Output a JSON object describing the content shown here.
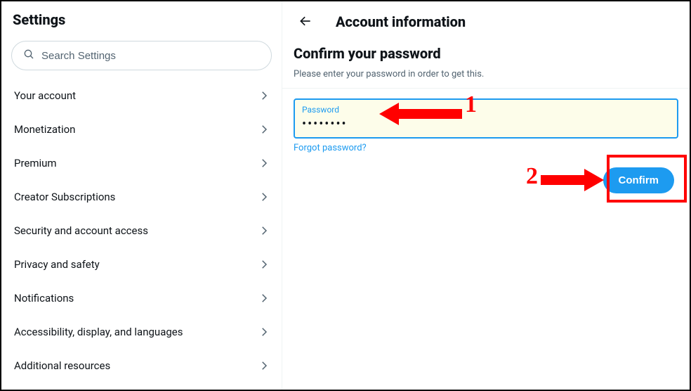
{
  "sidebar": {
    "title": "Settings",
    "search_placeholder": "Search Settings",
    "items": [
      {
        "label": "Your account"
      },
      {
        "label": "Monetization"
      },
      {
        "label": "Premium"
      },
      {
        "label": "Creator Subscriptions"
      },
      {
        "label": "Security and account access"
      },
      {
        "label": "Privacy and safety"
      },
      {
        "label": "Notifications"
      },
      {
        "label": "Accessibility, display, and languages"
      },
      {
        "label": "Additional resources"
      }
    ]
  },
  "main": {
    "header_title": "Account information",
    "section_title": "Confirm your password",
    "section_sub": "Please enter your password in order to get this.",
    "password_label": "Password",
    "password_value": "••••••••",
    "forgot_label": "Forgot password?",
    "confirm_label": "Confirm"
  },
  "annotations": {
    "num1": "1",
    "num2": "2"
  }
}
